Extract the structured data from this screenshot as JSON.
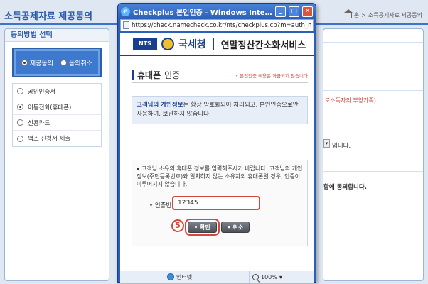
{
  "background": {
    "page_title": "소득공제자료 제공동의",
    "breadcrumb": [
      "홈",
      ">",
      "소득공제자료 제공동의"
    ],
    "left_panel": {
      "title": "동의방법 선택",
      "consent_options": [
        {
          "label": "제공동의",
          "selected": true
        },
        {
          "label": "동의취소",
          "selected": false
        }
      ],
      "methods": [
        {
          "label": "공인인증서",
          "selected": false
        },
        {
          "label": "이동전화(휴대폰)",
          "selected": true
        },
        {
          "label": "신용카드",
          "selected": false
        },
        {
          "label": "팩스 신청서 제출",
          "selected": false
        }
      ]
    },
    "right_panel": {
      "note": "로소득자의 부양가족)",
      "text1": "입니다.",
      "text2": "합에 동의합니다."
    }
  },
  "popup": {
    "window_title": "Checkplus 본인인증 - Windows Internet Expl...",
    "url": "https://check.namecheck.co.kr/nts/checkplus.cb?m=auth_m...",
    "brand": {
      "logo": "NTS",
      "name": "국세청",
      "service": "연말정산간소화서비스"
    },
    "section": {
      "title": "휴대폰",
      "subtitle": "인증",
      "note": "• 본인인증 비용은 과금되지 않습니다"
    },
    "info": {
      "strong": "고객님의 개인정보",
      "text": "는 항상 암호화되어 처리되고, 본인인증으로만 사용하며, 보관하지 않습니다."
    },
    "form": {
      "description": "고객님 소유의 휴대폰 정보를 입력해주시기 바랍니다. 고객님의 개인정보(주민등록번호)와 일치하지 않는 소유자의 휴대폰일 경우, 인증이 이루어지지 않습니다.",
      "code_label": "• 인증번호",
      "code_value": "12345",
      "step_number": "5",
      "confirm_label": "• 확인",
      "cancel_label": "• 취소"
    },
    "status": {
      "zone": "인터넷",
      "zoom": "100%"
    }
  },
  "colors": {
    "accent": "#2c5fb8",
    "brand": "#1b3f8f",
    "highlight": "#d6463b"
  }
}
